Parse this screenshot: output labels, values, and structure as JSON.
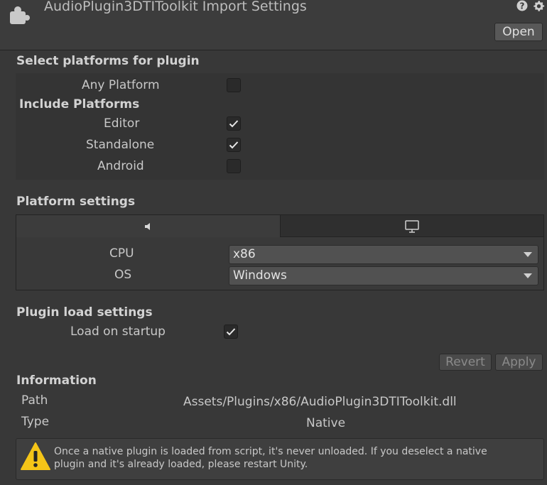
{
  "header": {
    "title": "AudioPlugin3DTIToolkit Import Settings",
    "open_label": "Open",
    "icons": [
      "plugin-icon",
      "help-icon",
      "gear-icon"
    ]
  },
  "platforms": {
    "section_title": "Select platforms for plugin",
    "any_platform": {
      "label": "Any Platform",
      "checked": false
    },
    "include_title": "Include Platforms",
    "items": [
      {
        "label": "Editor",
        "checked": true
      },
      {
        "label": "Standalone",
        "checked": true
      },
      {
        "label": "Android",
        "checked": false
      }
    ]
  },
  "platform_settings": {
    "section_title": "Platform settings",
    "tabs": [
      {
        "icon": "editor-unity-icon",
        "active": true
      },
      {
        "icon": "monitor-icon",
        "active": false
      }
    ],
    "cpu": {
      "label": "CPU",
      "value": "x86"
    },
    "os": {
      "label": "OS",
      "value": "Windows"
    }
  },
  "load_settings": {
    "section_title": "Plugin load settings",
    "load_on_startup": {
      "label": "Load on startup",
      "checked": true
    }
  },
  "actions": {
    "revert_label": "Revert",
    "apply_label": "Apply"
  },
  "information": {
    "section_title": "Information",
    "path_label": "Path",
    "path_value": "Assets/Plugins/x86/AudioPlugin3DTIToolkit.dll",
    "type_label": "Type",
    "type_value": "Native"
  },
  "warning": {
    "icon": "warning-icon",
    "line1": "Once a native plugin is loaded from script, it's never unloaded. If you deselect a native",
    "line2": "plugin and it's already loaded, please restart Unity.",
    "color": "#f5c518"
  }
}
